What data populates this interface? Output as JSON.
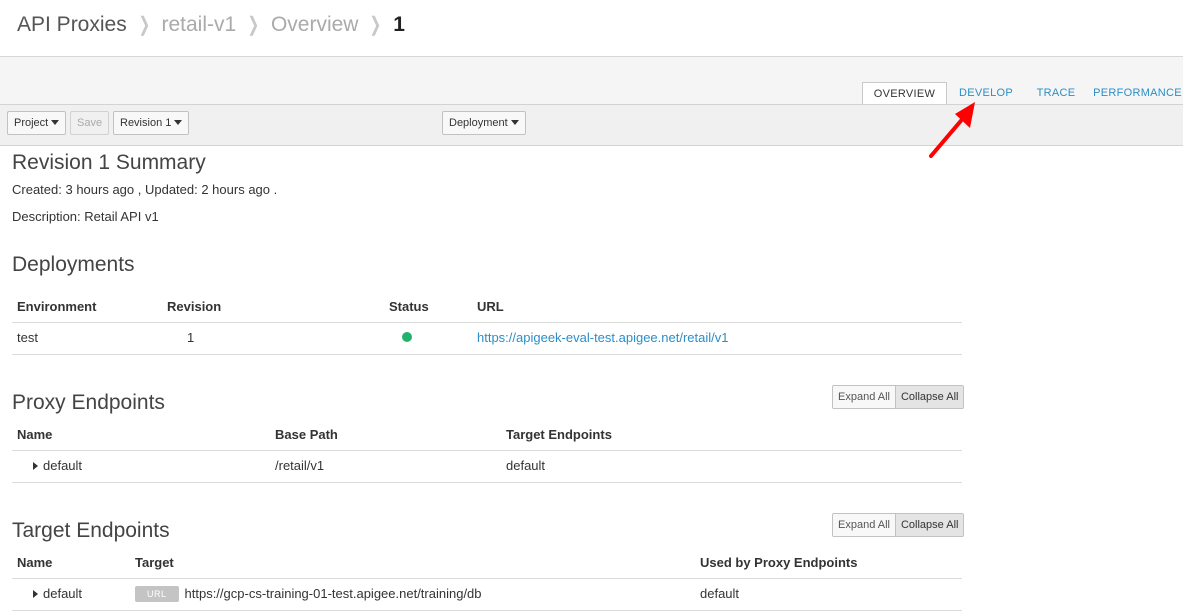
{
  "breadcrumb": {
    "root": "API Proxies",
    "proxy": "retail-v1",
    "section": "Overview",
    "revision": "1"
  },
  "tabs": [
    "OVERVIEW",
    "DEVELOP",
    "TRACE",
    "PERFORMANCE"
  ],
  "toolbar": {
    "project": "Project",
    "save": "Save",
    "revision": "Revision 1",
    "deployment": "Deployment"
  },
  "summary": {
    "title": "Revision 1 Summary",
    "created": "Created: 3 hours ago , Updated: 2 hours ago .",
    "description": "Description: Retail API v1"
  },
  "deployments": {
    "title": "Deployments",
    "headers": [
      "Environment",
      "Revision",
      "Status",
      "URL"
    ],
    "rows": [
      {
        "environment": "test",
        "revision": "1",
        "status_color": "#21b36b",
        "url": "https://apigeek-eval-test.apigee.net/retail/v1"
      }
    ]
  },
  "proxy_endpoints": {
    "title": "Proxy Endpoints",
    "expand_all": "Expand All",
    "collapse_all": "Collapse All",
    "headers": [
      "Name",
      "Base Path",
      "Target Endpoints"
    ],
    "rows": [
      {
        "name": "default",
        "base_path": "/retail/v1",
        "targets": "default"
      }
    ]
  },
  "target_endpoints": {
    "title": "Target Endpoints",
    "expand_all": "Expand All",
    "collapse_all": "Collapse All",
    "headers": [
      "Name",
      "Target",
      "Used by Proxy Endpoints"
    ],
    "rows": [
      {
        "name": "default",
        "badge": "URL",
        "target": "https://gcp-cs-training-01-test.apigee.net/training/db",
        "used_by": "default"
      }
    ]
  },
  "colors": {
    "link": "#2a8fc7",
    "status_ok": "#21b36b",
    "annotation_arrow": "#ff0000"
  },
  "icons": {
    "breadcrumb_separator": "chevron-right-icon",
    "dropdown": "caret-down-icon",
    "row_expand": "caret-right-icon",
    "status": "status-dot-icon",
    "annotation": "red-arrow-icon"
  }
}
